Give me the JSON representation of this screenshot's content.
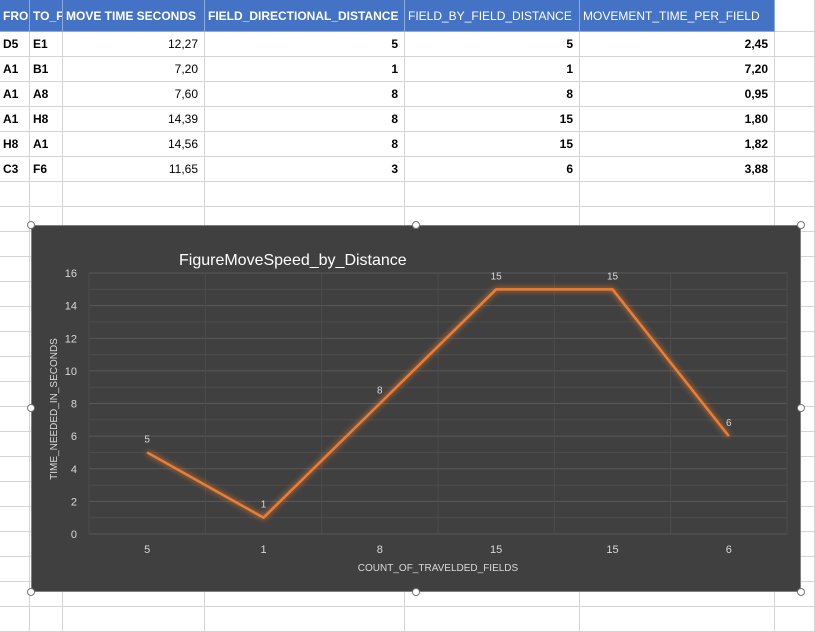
{
  "sheet": {
    "headers": [
      "FRO",
      "TO_F",
      "MOVE TIME SECONDS",
      "FIELD_DIRECTIONAL_DISTANCE",
      "FIELD_BY_FIELD_DISTANCE",
      "MOVEMENT_TIME_PER_FIELD"
    ],
    "rows": [
      [
        "D5",
        "E1",
        "12,27",
        "5",
        "5",
        "2,45"
      ],
      [
        "A1",
        "B1",
        "7,20",
        "1",
        "1",
        "7,20"
      ],
      [
        "A1",
        "A8",
        "7,60",
        "8",
        "8",
        "0,95"
      ],
      [
        "A1",
        "H8",
        "14,39",
        "8",
        "15",
        "1,80"
      ],
      [
        "H8",
        "A1",
        "14,56",
        "8",
        "15",
        "1,82"
      ],
      [
        "C3",
        "F6",
        "11,65",
        "3",
        "6",
        "3,88"
      ]
    ]
  },
  "chart_data": {
    "type": "line",
    "title": "FigureMoveSpeed_by_Distance",
    "xlabel": "COUNT_OF_TRAVELDED_FIELDS",
    "ylabel": "TIME_NEEDED_IN_SECONDS",
    "categories": [
      "5",
      "1",
      "8",
      "15",
      "15",
      "6"
    ],
    "series": [
      {
        "values": [
          5,
          1,
          8,
          15,
          15,
          6
        ],
        "color": "#ed7d31"
      }
    ],
    "ylim": [
      0,
      16
    ],
    "yticks": [
      "0",
      "2",
      "4",
      "6",
      "8",
      "10",
      "12",
      "14",
      "16"
    ],
    "data_labels": [
      "5",
      "1",
      "8",
      "15",
      "15",
      "6"
    ],
    "grid": true,
    "legend": "none",
    "background": "#404040"
  }
}
